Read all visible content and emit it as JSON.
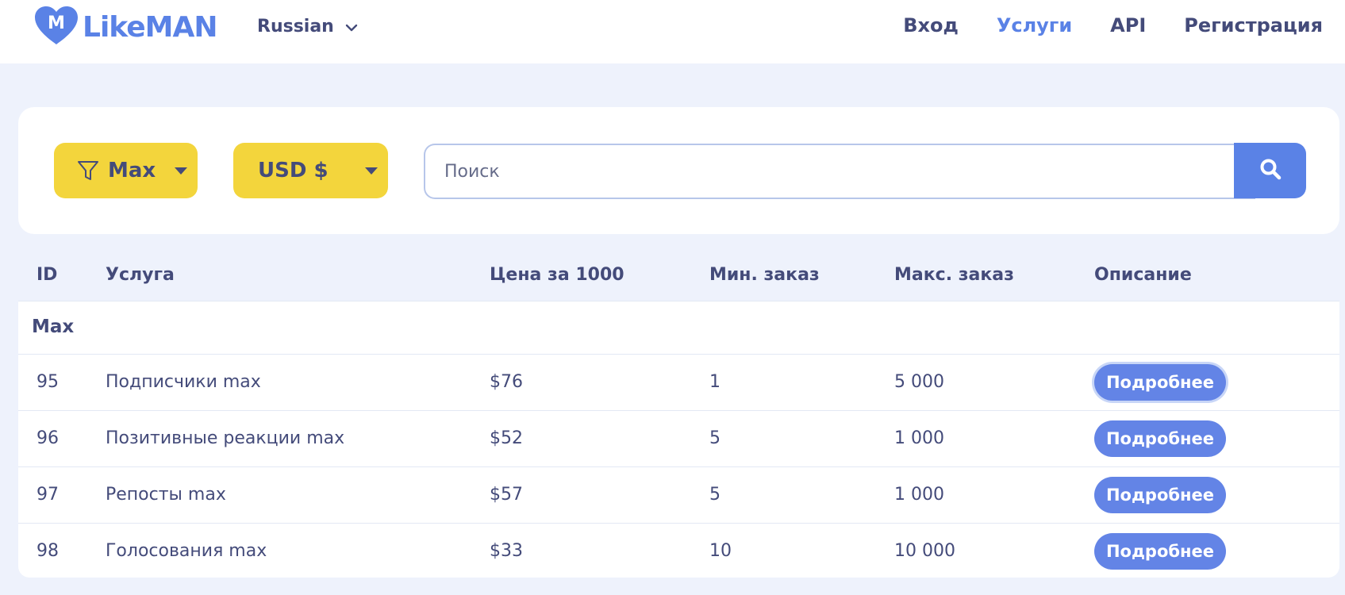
{
  "header": {
    "logo_text": "LikeMAN",
    "language": "Russian",
    "nav": [
      "Вход",
      "Услуги",
      "API",
      "Регистрация"
    ],
    "active_nav": "Услуги"
  },
  "filters": {
    "category": "Max",
    "currency": "USD $",
    "search_placeholder": "Поиск"
  },
  "table": {
    "columns": [
      "ID",
      "Услуга",
      "Цена за 1000",
      "Мин. заказ",
      "Макс. заказ",
      "Описание"
    ],
    "category_name": "Max",
    "rows": [
      {
        "id": "95",
        "name": "Подписчики max",
        "price": "$76",
        "min": "1",
        "max": "5 000",
        "button": "Подробнее"
      },
      {
        "id": "96",
        "name": "Позитивные реакции max",
        "price": "$52",
        "min": "5",
        "max": "1 000",
        "button": "Подробнее"
      },
      {
        "id": "97",
        "name": "Репосты max",
        "price": "$57",
        "min": "5",
        "max": "1 000",
        "button": "Подробнее"
      },
      {
        "id": "98",
        "name": "Голосования max",
        "price": "$33",
        "min": "10",
        "max": "10 000",
        "button": "Подробнее"
      }
    ]
  },
  "colors": {
    "brand_blue": "#5a82e6",
    "yellow": "#f3d53c",
    "text": "#444b7a",
    "background": "#eef2fc"
  }
}
